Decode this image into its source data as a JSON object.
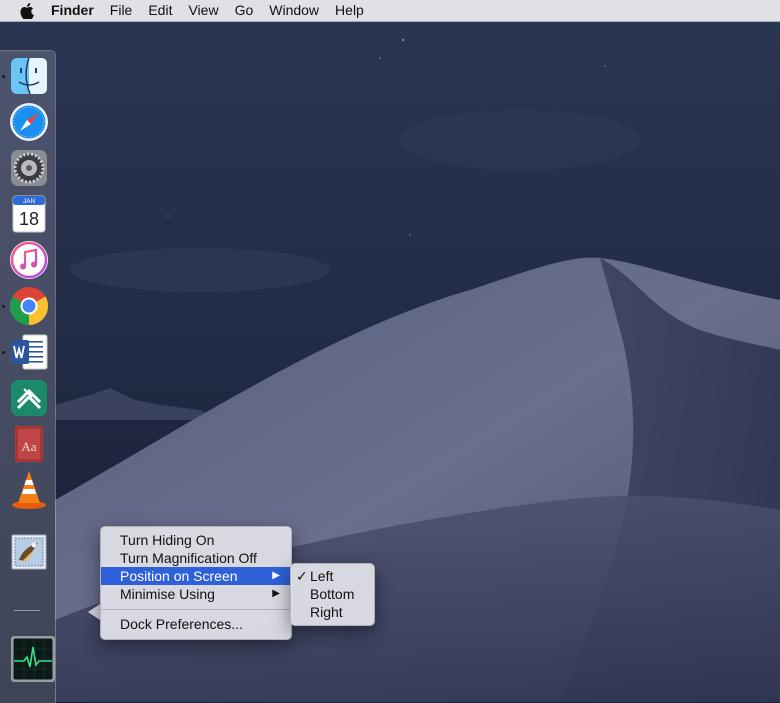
{
  "menubar": {
    "app_name": "Finder",
    "items": [
      "File",
      "Edit",
      "View",
      "Go",
      "Window",
      "Help"
    ]
  },
  "dock": {
    "apps": [
      {
        "icon": "finder-icon",
        "running": true
      },
      {
        "icon": "safari-icon",
        "running": false
      },
      {
        "icon": "system-preferences-icon",
        "running": false
      },
      {
        "icon": "calendar-icon",
        "running": false,
        "month": "JAN",
        "day": "18"
      },
      {
        "icon": "itunes-icon",
        "running": false
      },
      {
        "icon": "chrome-icon",
        "running": true
      },
      {
        "icon": "word-icon",
        "running": true
      },
      {
        "icon": "app-icon",
        "running": false
      },
      {
        "icon": "dictionary-icon",
        "running": false,
        "label": "Aa"
      },
      {
        "icon": "vlc-icon",
        "running": false
      },
      {
        "icon": "mail-icon",
        "running": false
      },
      {
        "icon": "activity-monitor-icon",
        "running": false
      }
    ]
  },
  "context_menu": {
    "items": {
      "hiding": "Turn Hiding On",
      "magnification": "Turn Magnification Off",
      "position": "Position on Screen",
      "minimise": "Minimise Using",
      "preferences": "Dock Preferences..."
    },
    "highlighted": "Position on Screen"
  },
  "position_submenu": {
    "options": [
      "Left",
      "Bottom",
      "Right"
    ],
    "selected": "Left",
    "check_mark": "✓"
  },
  "colors": {
    "highlight": "#2e61d7",
    "sky_top": "#27324f",
    "sky_bottom": "#1a2238"
  }
}
